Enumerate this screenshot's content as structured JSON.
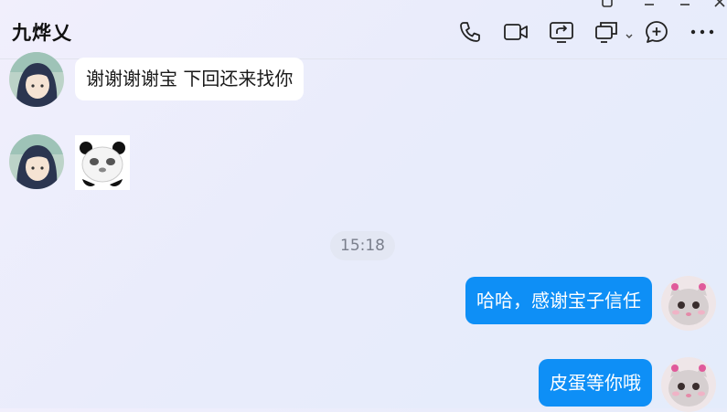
{
  "header": {
    "title": "九烨乂",
    "toolbar": [
      {
        "name": "phone-call-icon",
        "label": "voice call"
      },
      {
        "name": "video-call-icon",
        "label": "video call"
      },
      {
        "name": "screen-share-icon",
        "label": "screen share"
      },
      {
        "name": "remote-control-icon",
        "label": "remote assist"
      },
      {
        "name": "add-member-icon",
        "label": "add"
      },
      {
        "name": "more-icon",
        "label": "more"
      }
    ]
  },
  "messages": {
    "incoming_1": "谢谢谢谢宝 下回还来找你",
    "timestamp": "15:18",
    "outgoing_1": "哈哈，感谢宝子信任",
    "outgoing_2": "皮蛋等你哦"
  },
  "colors": {
    "accent": "#0e8ff6",
    "incoming_bubble": "#ffffff",
    "text": "#1a1a1a"
  }
}
